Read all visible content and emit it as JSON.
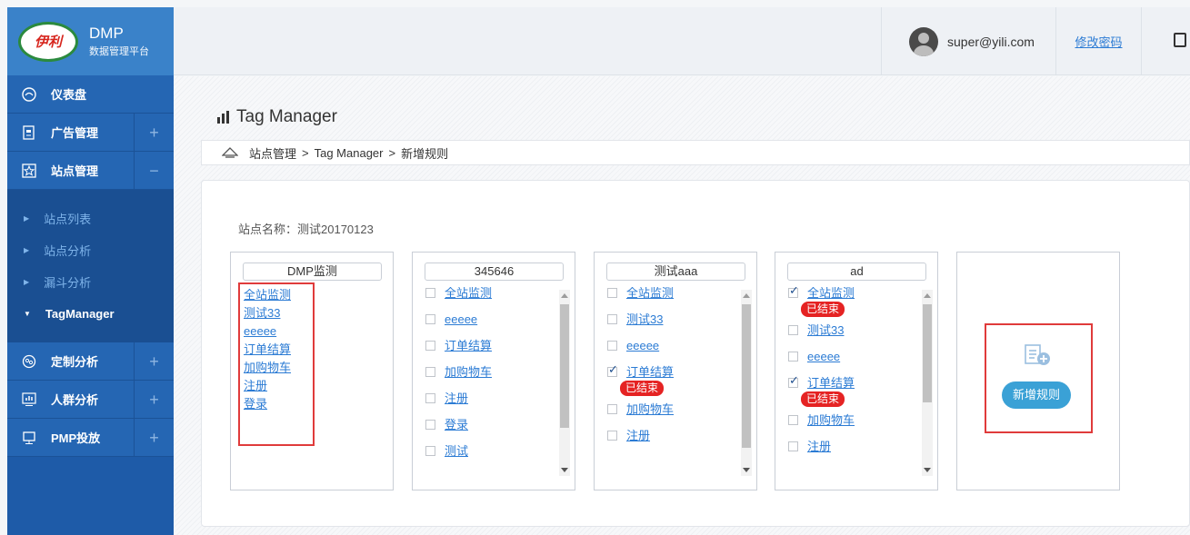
{
  "brand": {
    "logo_text": "伊利",
    "title": "DMP",
    "subtitle": "数据管理平台"
  },
  "sidebar": {
    "items": [
      {
        "label": "仪表盘",
        "icon": "dashboard-icon",
        "toggle": ""
      },
      {
        "label": "广告管理",
        "icon": "ad-report-icon",
        "toggle": "+"
      },
      {
        "label": "站点管理",
        "icon": "site-star-icon",
        "toggle": "−"
      },
      {
        "label": "定制分析",
        "icon": "custom-analysis-icon",
        "toggle": "+"
      },
      {
        "label": "人群分析",
        "icon": "crowd-chart-icon",
        "toggle": "+"
      },
      {
        "label": "PMP投放",
        "icon": "monitor-icon",
        "toggle": "+"
      }
    ],
    "submenu": [
      {
        "label": "站点列表",
        "arrow": "▶"
      },
      {
        "label": "站点分析",
        "arrow": "▶"
      },
      {
        "label": "漏斗分析",
        "arrow": "▶"
      },
      {
        "label": "TagManager",
        "arrow": "▼"
      }
    ]
  },
  "header": {
    "user_email": "super@yili.com",
    "change_password": "修改密码"
  },
  "page": {
    "title": "Tag Manager",
    "breadcrumb": [
      "站点管理",
      "Tag Manager",
      "新增规则"
    ],
    "breadcrumb_sep": ">",
    "site_name": "站点名称：测试20170123"
  },
  "cards": [
    {
      "name": "DMP监测",
      "items": [
        {
          "label": "全站监测"
        },
        {
          "label": "测试33"
        },
        {
          "label": "eeeee"
        },
        {
          "label": "订单结算"
        },
        {
          "label": "加购物车"
        },
        {
          "label": "注册"
        },
        {
          "label": "登录"
        }
      ]
    },
    {
      "name": "345646",
      "items": [
        {
          "label": "全站监测",
          "checked": false
        },
        {
          "label": "eeeee",
          "checked": false
        },
        {
          "label": "订单结算",
          "checked": false
        },
        {
          "label": "加购物车",
          "checked": false
        },
        {
          "label": "注册",
          "checked": false
        },
        {
          "label": "登录",
          "checked": false
        },
        {
          "label": "测试",
          "checked": false
        }
      ]
    },
    {
      "name": "测试aaa",
      "items": [
        {
          "label": "全站监测",
          "checked": false
        },
        {
          "label": "测试33",
          "checked": false
        },
        {
          "label": "eeeee",
          "checked": false
        },
        {
          "label": "订单结算",
          "checked": true,
          "badge": "已结束"
        },
        {
          "label": "加购物车",
          "checked": false
        },
        {
          "label": "注册",
          "checked": false
        }
      ]
    },
    {
      "name": "ad",
      "items": [
        {
          "label": "全站监测",
          "checked": true,
          "badge": "已结束"
        },
        {
          "label": "测试33",
          "checked": false
        },
        {
          "label": "eeeee",
          "checked": false
        },
        {
          "label": "订单结算",
          "checked": true,
          "badge": "已结束"
        },
        {
          "label": "加购物车",
          "checked": false
        },
        {
          "label": "注册",
          "checked": false
        }
      ]
    }
  ],
  "add_rule_label": "新增规则",
  "colors": {
    "sidebar": "#1e5ba8",
    "brand_bar": "#3a82c9",
    "link": "#2b7bd4",
    "badge": "#e52323",
    "highlight_box": "#e03b3b",
    "add_button": "#3aa1d6"
  }
}
